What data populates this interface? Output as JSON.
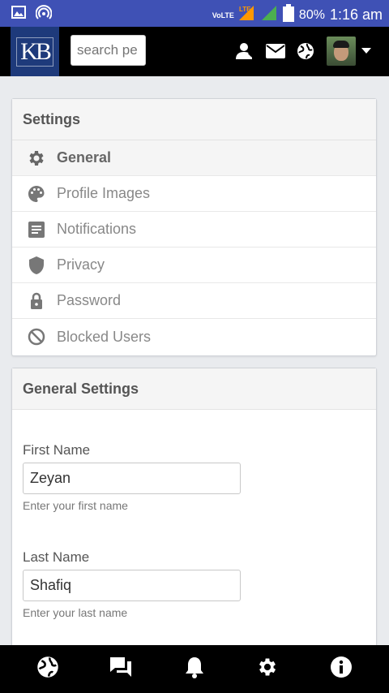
{
  "status_bar": {
    "volte": "VoLTE",
    "lte": "LTE",
    "battery": "80%",
    "time": "1:16 am"
  },
  "navbar": {
    "logo_text": "KB",
    "search_placeholder": "search pe"
  },
  "settings_panel": {
    "title": "Settings",
    "items": [
      {
        "label": "General",
        "icon": "gear-icon",
        "active": true
      },
      {
        "label": "Profile Images",
        "icon": "palette-icon",
        "active": false
      },
      {
        "label": "Notifications",
        "icon": "article-icon",
        "active": false
      },
      {
        "label": "Privacy",
        "icon": "shield-icon",
        "active": false
      },
      {
        "label": "Password",
        "icon": "lock-icon",
        "active": false
      },
      {
        "label": "Blocked Users",
        "icon": "block-icon",
        "active": false
      }
    ]
  },
  "general_settings": {
    "title": "General Settings",
    "first_name": {
      "label": "First Name",
      "value": "Zeyan",
      "help": "Enter your first name"
    },
    "last_name": {
      "label": "Last Name",
      "value": "Shafiq",
      "help": "Enter your last name"
    }
  },
  "bottom_nav": [
    "globe-icon",
    "chat-icon",
    "bell-icon",
    "gear-icon",
    "info-icon"
  ],
  "colors": {
    "status_bar": "#3f51b5",
    "logo_bg": "#1e3a7b",
    "nav_bg": "#000000",
    "page_bg": "#e9ebee"
  }
}
